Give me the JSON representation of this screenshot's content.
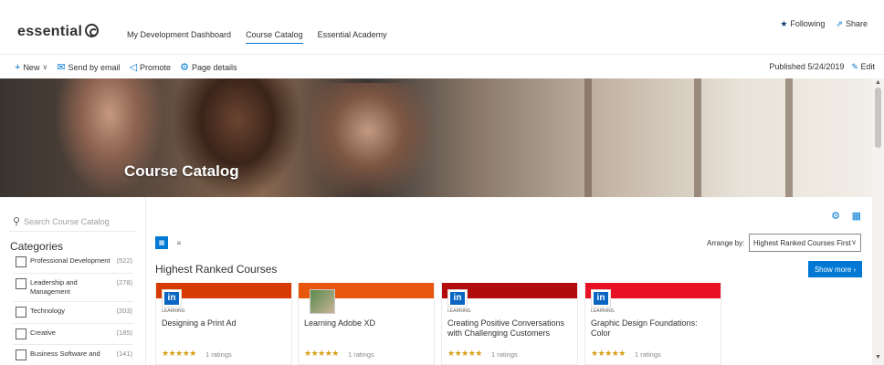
{
  "header": {
    "logo": "essential",
    "nav": [
      "My Development Dashboard",
      "Course Catalog",
      "Essential Academy"
    ],
    "active_nav": 1,
    "following": "Following",
    "share": "Share"
  },
  "commands": {
    "new": "New",
    "send": "Send by email",
    "promote": "Promote",
    "details": "Page details",
    "published": "Published 5/24/2019",
    "edit": "Edit"
  },
  "hero": {
    "title": "Course Catalog"
  },
  "sidebar": {
    "search_placeholder": "Search Course Catalog",
    "categories_title": "Categories",
    "categories": [
      {
        "label": "Professional Development",
        "count": "(522)"
      },
      {
        "label": "Leadership and Management",
        "count": "(278)"
      },
      {
        "label": "Technology",
        "count": "(203)"
      },
      {
        "label": "Creative",
        "count": "(185)"
      },
      {
        "label": "Business Software and",
        "count": "(141)"
      }
    ]
  },
  "main": {
    "arrange_label": "Arrange by:",
    "arrange_value": "Highest Ranked Courses First",
    "section_title": "Highest Ranked Courses",
    "show_more": "Show more",
    "learning_label": "LEARNING",
    "courses": [
      {
        "title": "Designing a Print Ad",
        "rating": "1 ratings",
        "band": "#d83b01",
        "logo": "linkedin"
      },
      {
        "title": "Learning Adobe XD",
        "rating": "1 ratings",
        "band": "#e8550c",
        "logo": "thumbnail"
      },
      {
        "title": "Creating Positive Conversations with Challenging Customers",
        "rating": "1 ratings",
        "band": "#b30c0c",
        "logo": "linkedin"
      },
      {
        "title": "Graphic Design Foundations: Color",
        "rating": "1 ratings",
        "band": "#e81123",
        "logo": "linkedin"
      }
    ]
  },
  "colors": {
    "accent": "#0078d4",
    "star": "#d4a017"
  }
}
